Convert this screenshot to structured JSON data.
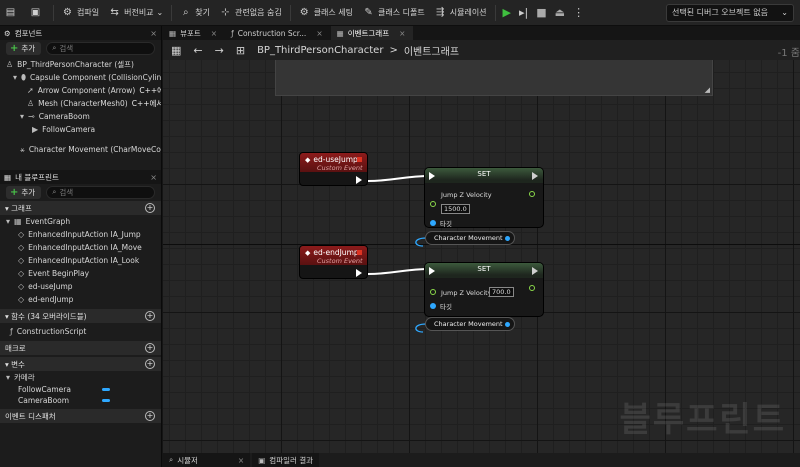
{
  "toolbar": {
    "compile": "컴파일",
    "diff": "버전비교",
    "find": "찾기",
    "hide_unrelated": "관련없음 숨김",
    "class_settings": "클래스 세팅",
    "class_defaults": "클래스 디폴트",
    "simulation": "시뮬레이션",
    "debug_select": "선택된 디버그 오브젝트 없음"
  },
  "left_panel": {
    "components_tab": "컴포넌트",
    "add_label": "추가",
    "search_placeholder": "검색",
    "components": {
      "root": "BP_ThirdPersonCharacter (셀프)",
      "capsule": "Capsule Component (CollisionCylinder)",
      "arrow": "Arrow Component (Arrow)",
      "arrow_tag": "C++에서 편",
      "mesh": "Mesh (CharacterMesh0)",
      "mesh_tag": "C++에서 편집",
      "camera_boom": "CameraBoom",
      "follow_camera": "FollowCamera",
      "movement": "Character Movement (CharMoveComp)"
    },
    "my_blueprint_tab": "내 블루프린트",
    "graphs_section": "그래프",
    "graph_items": [
      "EventGraph",
      "EnhancedInputAction IA_Jump",
      "EnhancedInputAction IA_Move",
      "EnhancedInputAction IA_Look",
      "Event BeginPlay",
      "ed-useJump",
      "ed-endJump"
    ],
    "functions_section": "함수 (34 오버라이드블)",
    "function_items": [
      "ConstructionScript"
    ],
    "macros_section": "매크로",
    "variables_section": "변수",
    "variable_category": "카메라",
    "variable_items": [
      "FollowCamera",
      "CameraBoom"
    ],
    "event_dispatchers_section": "이벤트 디스패처"
  },
  "doc_tabs": [
    "뷰포트",
    "Construction Scr...",
    "이벤트그래프"
  ],
  "nav": {
    "breadcrumb_root": "BP_ThirdPersonCharacter",
    "breadcrumb_sep": ">",
    "breadcrumb_leaf": "이벤트그래프",
    "zoom": "-1 줌"
  },
  "graph": {
    "event1": {
      "title": "ed-useJump",
      "subtitle": "Custom Event"
    },
    "event2": {
      "title": "ed-endJump",
      "subtitle": "Custom Event"
    },
    "set1": {
      "title": "SET",
      "var": "Jump Z Velocity",
      "value": "1500.0",
      "target": "타깃",
      "target_var": "Character Movement"
    },
    "set2": {
      "title": "SET",
      "var": "Jump Z Velocity",
      "value": "700.0",
      "target": "타깃",
      "target_var": "Character Movement"
    },
    "watermark": "블루프린트"
  },
  "bottom_tabs": [
    "시뮬저",
    "컴파일러 결과"
  ]
}
